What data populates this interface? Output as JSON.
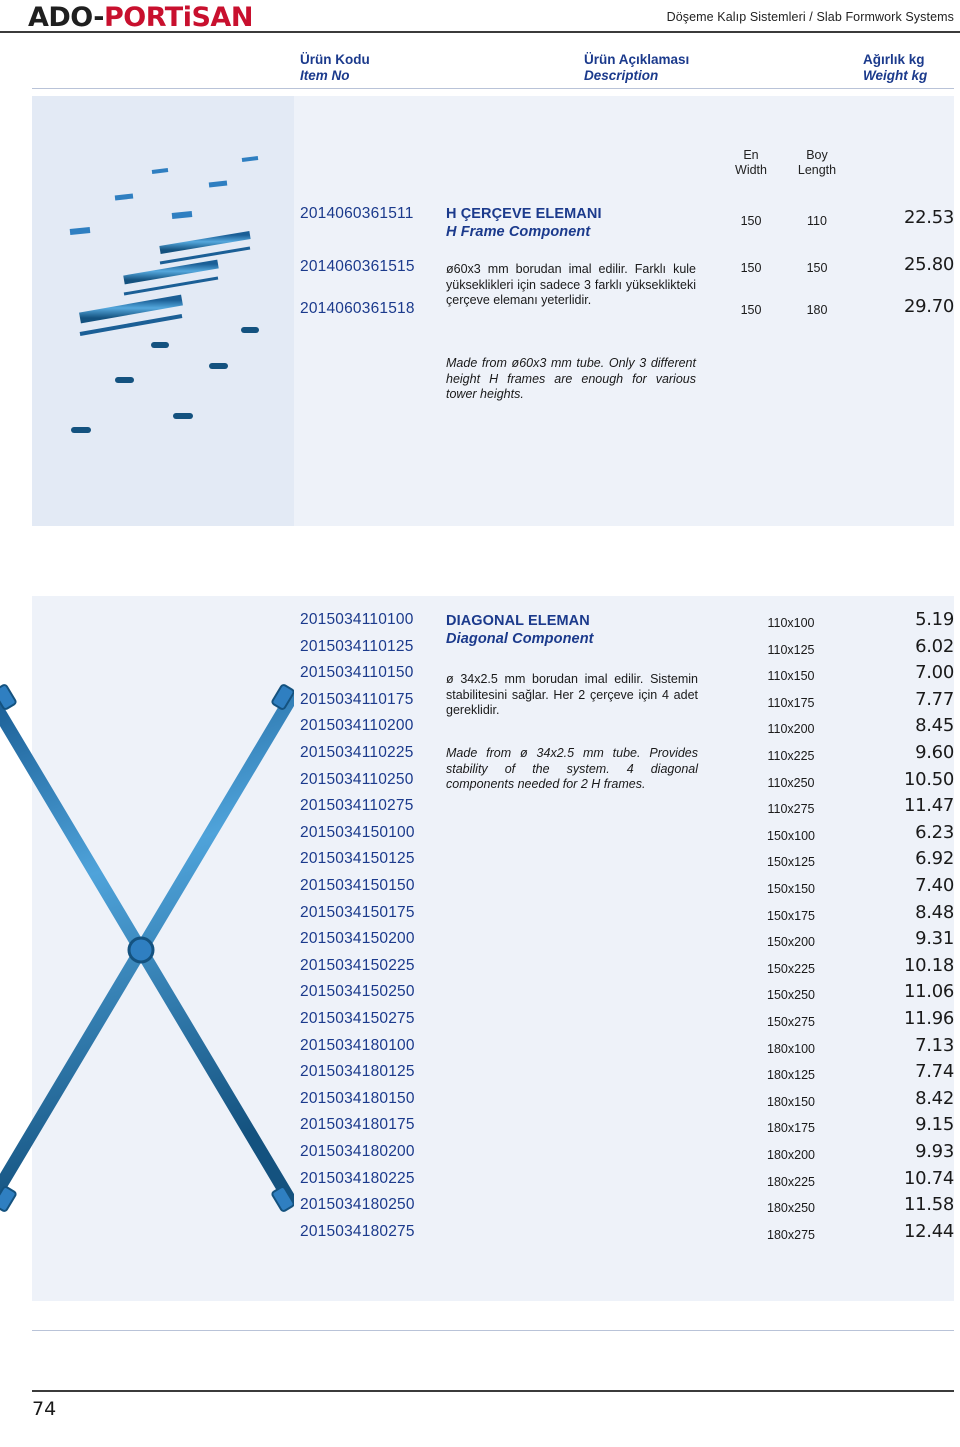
{
  "header": {
    "logo_ado": "ADO",
    "logo_dash": "-",
    "logo_portisan": "PORTiSAN",
    "title": "Döşeme Kalıp Sistemleri / Slab Formwork Systems"
  },
  "columns": {
    "code_tr": "Ürün Kodu",
    "code_en": "Item No",
    "desc_tr": "Ürün Açıklaması",
    "desc_en": "Description",
    "weight_tr": "Ağırlık kg",
    "weight_en": "Weight kg"
  },
  "subheaders": {
    "en_tr": "En",
    "en_en": "Width",
    "boy_tr": "Boy",
    "boy_en": "Length"
  },
  "products": [
    {
      "title_tr": "H ÇERÇEVE ELEMANI",
      "title_en": "H Frame Component",
      "body_tr": "ø60x3 mm borudan imal edilir. Farklı kule yükseklikleri için sadece 3 farklı yükseklikteki çerçeve elemanı yeterlidir.",
      "body_en": "Made from ø60x3 mm tube. Only 3 different height H frames are enough for various tower heights.",
      "codes": [
        "2014060361511",
        "2014060361515",
        "2014060361518"
      ],
      "rows": [
        {
          "width": "150",
          "length": "110",
          "weight": "22.53"
        },
        {
          "width": "150",
          "length": "150",
          "weight": "25.80"
        },
        {
          "width": "150",
          "length": "180",
          "weight": "29.70"
        }
      ]
    },
    {
      "title_tr": "DIAGONAL ELEMAN",
      "title_en": "Diagonal Component",
      "body_tr": "ø 34x2.5 mm borudan imal edilir. Sistemin stabilitesini sağlar. Her 2 çerçeve için 4 adet gereklidir.",
      "body_en": "Made from ø 34x2.5 mm tube. Provides stability of the system. 4 diagonal components needed for 2 H frames.",
      "rows": [
        {
          "code": "2015034110100",
          "size": "110x100",
          "weight": "5.19"
        },
        {
          "code": "2015034110125",
          "size": "110x125",
          "weight": "6.02"
        },
        {
          "code": "2015034110150",
          "size": "110x150",
          "weight": "7.00"
        },
        {
          "code": "2015034110175",
          "size": "110x175",
          "weight": "7.77"
        },
        {
          "code": "2015034110200",
          "size": "110x200",
          "weight": "8.45"
        },
        {
          "code": "2015034110225",
          "size": "110x225",
          "weight": "9.60"
        },
        {
          "code": "2015034110250",
          "size": "110x250",
          "weight": "10.50"
        },
        {
          "code": "2015034110275",
          "size": "110x275",
          "weight": "11.47"
        },
        {
          "code": "2015034150100",
          "size": "150x100",
          "weight": "6.23"
        },
        {
          "code": "2015034150125",
          "size": "150x125",
          "weight": "6.92"
        },
        {
          "code": "2015034150150",
          "size": "150x150",
          "weight": "7.40"
        },
        {
          "code": "2015034150175",
          "size": "150x175",
          "weight": "8.48"
        },
        {
          "code": "2015034150200",
          "size": "150x200",
          "weight": "9.31"
        },
        {
          "code": "2015034150225",
          "size": "150x225",
          "weight": "10.18"
        },
        {
          "code": "2015034150250",
          "size": "150x250",
          "weight": "11.06"
        },
        {
          "code": "2015034150275",
          "size": "150x275",
          "weight": "11.96"
        },
        {
          "code": "2015034180100",
          "size": "180x100",
          "weight": "7.13"
        },
        {
          "code": "2015034180125",
          "size": "180x125",
          "weight": "7.74"
        },
        {
          "code": "2015034180150",
          "size": "180x150",
          "weight": "8.42"
        },
        {
          "code": "2015034180175",
          "size": "180x175",
          "weight": "9.15"
        },
        {
          "code": "2015034180200",
          "size": "180x200",
          "weight": "9.93"
        },
        {
          "code": "2015034180225",
          "size": "180x225",
          "weight": "10.74"
        },
        {
          "code": "2015034180250",
          "size": "180x250",
          "weight": "11.58"
        },
        {
          "code": "2015034180275",
          "size": "180x275",
          "weight": "12.44"
        }
      ]
    }
  ],
  "page_number": "74",
  "colors": {
    "accent_blue": "#1b3a8c",
    "brand_red": "#c8102e",
    "band": "#eef2f9",
    "tube_blue": "#2f7fc1"
  }
}
